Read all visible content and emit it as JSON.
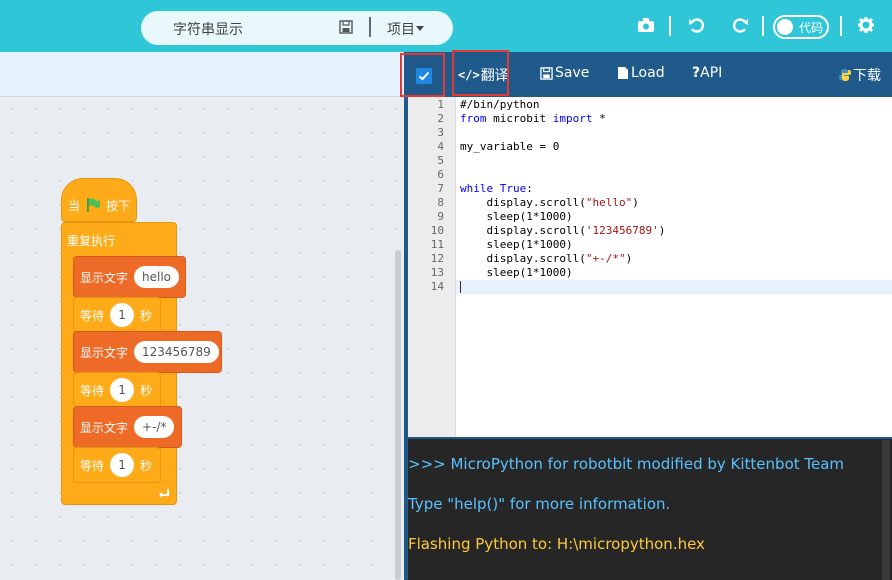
{
  "topbar": {
    "project_name": "字符串显示",
    "project_menu": "项目",
    "code_toggle_label": "代码"
  },
  "blocks": {
    "when_label_1": "当",
    "when_label_2": "按下",
    "repeat_label": "重复执行",
    "display_label": "显示文字",
    "wait_label": "等待",
    "seconds_label": "秒",
    "items": [
      {
        "text": "hello",
        "wait": "1"
      },
      {
        "text": "123456789",
        "wait": "1"
      },
      {
        "text": "+-/*",
        "wait": "1"
      }
    ]
  },
  "codebar": {
    "translate_label": "翻译",
    "save_label": "Save",
    "load_label": "Load",
    "api_label": "API",
    "download_label": "下载",
    "checkbox_checked": true
  },
  "code": {
    "line_numbers": [
      "1",
      "2",
      "3",
      "4",
      "5",
      "6",
      "7",
      "8",
      "9",
      "10",
      "11",
      "12",
      "13",
      "14"
    ],
    "lines": [
      "#/bin/python",
      "from microbit import *",
      "",
      "my_variable = 0",
      "",
      "",
      "while True:",
      "    display.scroll(\"hello\")",
      "    sleep(1*1000)",
      "    display.scroll('123456789')",
      "    sleep(1*1000)",
      "    display.scroll(\"+-/*\")",
      "    sleep(1*1000)",
      ""
    ]
  },
  "console": {
    "lines": [
      {
        "text": ">>> MicroPython for robotbit modified by Kittenbot Team",
        "color": "#5bc0ff"
      },
      {
        "text": "Type \"help()\" for more information.",
        "color": "#5bc0ff"
      },
      {
        "text": "Flashing Python to: H:\\micropython.hex",
        "color": "#ffc93c"
      }
    ]
  },
  "colors": {
    "topbar": "#2fc7d7",
    "codebar": "#1f5a8a",
    "event_block": "#ffab19",
    "looks_block": "#ee6b27",
    "highlight": "#e53935"
  }
}
